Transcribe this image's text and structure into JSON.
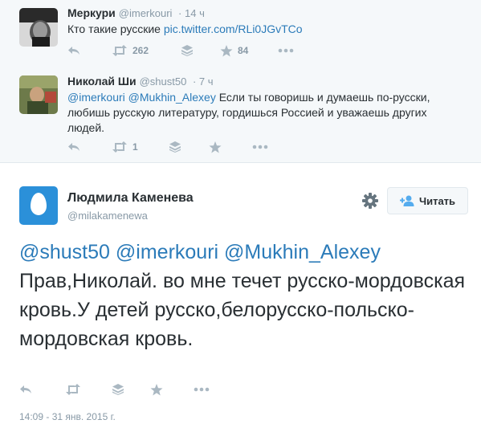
{
  "tweet1": {
    "name": "Меркури",
    "handle": "@imerkouri",
    "time": "14 ч",
    "text": "Кто такие русские ",
    "link": "pic.twitter.com/RLi0JGvTCo",
    "retweets": "262",
    "favorites": "84"
  },
  "tweet2": {
    "name": "Николай Ши",
    "handle": "@shust50",
    "time": "7 ч",
    "mentions": "@imerkouri @Mukhin_Alexey",
    "text": " Если ты говоришь и думаешь по-русски, любишь русскую литературу, гордишься Россией и уважаешь других людей.",
    "retweets": "1"
  },
  "main": {
    "name": "Людмила Каменева",
    "handle": "@milakamenewa",
    "follow_label": "Читать",
    "mention1": "@shust50",
    "mention2": "@imerkouri",
    "mention3": "@Mukhin_Alexey",
    "text": "Прав,Николай. во мне течет русско-мордовская кровь.У детей русско,белорусско-польско-мордовская кровь.",
    "timestamp": "14:09 - 31 янв. 2015 г."
  },
  "colors": {
    "link": "#2b7bb9",
    "muted": "#8899a6",
    "avatar": "#2b90d9"
  },
  "icons": [
    "reply-icon",
    "retweet-icon",
    "buffer-icon",
    "favorite-icon",
    "more-icon",
    "gear-icon",
    "follow-icon"
  ]
}
